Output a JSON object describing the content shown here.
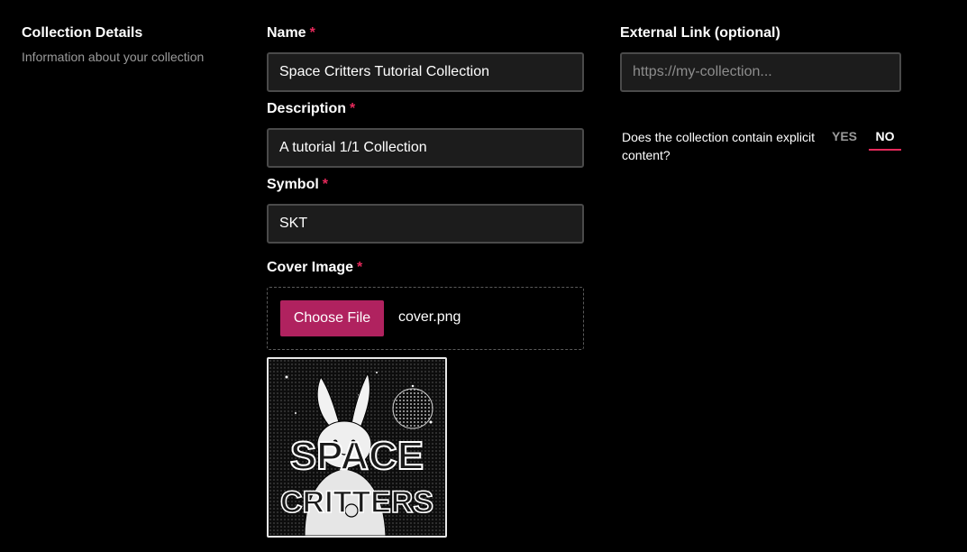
{
  "section": {
    "title": "Collection Details",
    "subtitle": "Information about your collection"
  },
  "fields": {
    "name": {
      "label": "Name",
      "required_mark": "*",
      "value": "Space Critters Tutorial Collection"
    },
    "description": {
      "label": "Description",
      "required_mark": "*",
      "value": "A tutorial 1/1 Collection"
    },
    "symbol": {
      "label": "Symbol",
      "required_mark": "*",
      "value": "SKT"
    },
    "cover_image": {
      "label": "Cover Image",
      "required_mark": "*",
      "button_label": "Choose File",
      "file_name": "cover.png",
      "preview_text_line1": "SPACE",
      "preview_text_line2": "CRITTERS"
    },
    "external_link": {
      "label": "External Link (optional)",
      "placeholder": "https://my-collection..."
    }
  },
  "explicit": {
    "question": "Does the collection contain explicit content?",
    "yes_label": "YES",
    "no_label": "NO",
    "selected": "NO"
  },
  "colors": {
    "accent": "#e5295b",
    "button": "#b0225f",
    "input_bg": "#1c1c1c",
    "background": "#000000"
  }
}
